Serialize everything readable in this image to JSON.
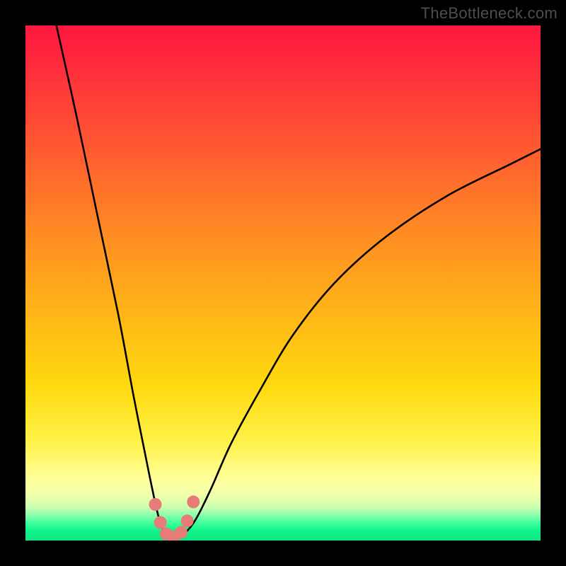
{
  "attribution": "TheBottleneck.com",
  "chart_data": {
    "type": "line",
    "title": "",
    "xlabel": "",
    "ylabel": "",
    "x_range": [
      0,
      100
    ],
    "y_range": [
      0,
      100
    ],
    "series": [
      {
        "name": "bottleneck-curve",
        "x": [
          6,
          10,
          14,
          18,
          21,
          24,
          26,
          27.5,
          29,
          30.5,
          33,
          36,
          40,
          46,
          52,
          60,
          70,
          82,
          94,
          100
        ],
        "y": [
          100,
          82,
          63,
          44,
          28,
          13,
          4,
          1,
          0.5,
          1,
          4,
          10,
          19,
          30,
          40,
          50,
          59,
          67,
          73,
          76
        ]
      }
    ],
    "markers": {
      "name": "pink-dots",
      "x": [
        25.2,
        26.2,
        27.3,
        28.8,
        30.2,
        31.4,
        32.6
      ],
      "y": [
        7.0,
        3.5,
        1.3,
        0.7,
        1.6,
        3.8,
        7.5
      ]
    },
    "gradient_stops": [
      {
        "pct": 0,
        "color": "#ff163f"
      },
      {
        "pct": 22,
        "color": "#ff5432"
      },
      {
        "pct": 55,
        "color": "#ffb318"
      },
      {
        "pct": 81,
        "color": "#fff24a"
      },
      {
        "pct": 93,
        "color": "#cdffb0"
      },
      {
        "pct": 100,
        "color": "#0ee784"
      }
    ]
  }
}
